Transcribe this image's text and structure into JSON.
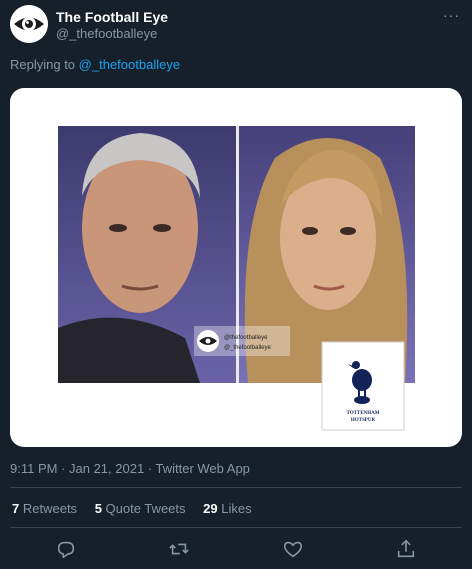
{
  "tweet": {
    "display_name": "The Football Eye",
    "handle": "@_thefootballeye",
    "more_label": "···",
    "replying_prefix": "Replying to",
    "replying_handle": "@_thefootballeye",
    "timestamp": "9:11 PM · Jan 21, 2021 · Twitter Web App"
  },
  "image": {
    "watermark_handle_1": "@thefootballeye",
    "watermark_handle_2": "@_thefootballeye",
    "crest_text_1": "TOTTENHAM",
    "crest_text_2": "HOTSPUR"
  },
  "stats": {
    "retweets_count": "7",
    "retweets_label": "Retweets",
    "quotes_count": "5",
    "quotes_label": "Quote Tweets",
    "likes_count": "29",
    "likes_label": "Likes"
  },
  "colors": {
    "background": "#15202b",
    "link": "#1da1f2",
    "muted": "#8899a6",
    "divider": "#38444d"
  },
  "icons": {
    "reply": "reply-icon",
    "retweet": "retweet-icon",
    "like": "heart-icon",
    "share": "share-icon"
  }
}
